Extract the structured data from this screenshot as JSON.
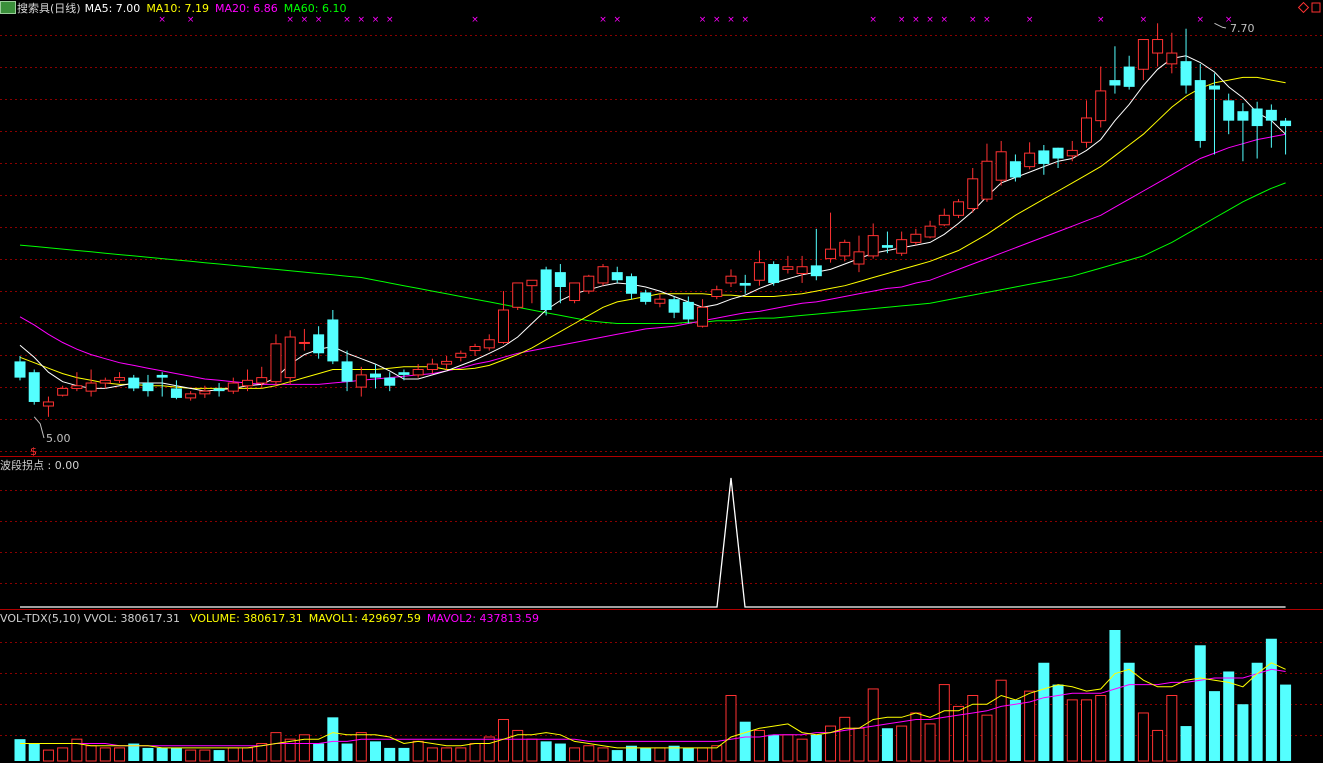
{
  "header": {
    "title": "搜索具(日线)",
    "ma5_label": "MA5: 7.00",
    "ma10_label": "MA10: 7.19",
    "ma20_label": "MA20: 6.86",
    "ma60_label": "MA60: 6.10"
  },
  "indicator": {
    "label": "波段拐点 : 0.00"
  },
  "volume_header": {
    "name": "VOL-TDX(5,10)",
    "vvol": "VVOL: 380617.31",
    "volume": "VOLUME: 380617.31",
    "mavol1": "MAVOL1: 429697.59",
    "mavol2": "MAVOL2: 437813.59"
  },
  "annotations": {
    "high_label": "7.70",
    "low_label": "5.00",
    "buy_mark": "$"
  },
  "colors": {
    "up": "#ff3232",
    "down": "#54ffff",
    "ma5": "#ffffff",
    "ma10": "#ffff00",
    "ma20": "#ff00ff",
    "ma60": "#00ff00",
    "grid": "#8a0000",
    "signal": "#ff00ff"
  },
  "chart_data": {
    "type": "candlestick",
    "price_range": [
      4.75,
      7.9
    ],
    "x": [
      0,
      1,
      2,
      3,
      4,
      5,
      6,
      7,
      8,
      9,
      10,
      11,
      12,
      13,
      14,
      15,
      16,
      17,
      18,
      19,
      20,
      21,
      22,
      23,
      24,
      25,
      26,
      27,
      28,
      29,
      30,
      31,
      32,
      33,
      34,
      35,
      36,
      37,
      38,
      39,
      40,
      41,
      42,
      43,
      44,
      45,
      46,
      47,
      48,
      49,
      50,
      51,
      52,
      53,
      54,
      55,
      56,
      57,
      58,
      59,
      60,
      61,
      62,
      63,
      64,
      65,
      66,
      67,
      68,
      69,
      70,
      71,
      72,
      73,
      74,
      75,
      76,
      77,
      78,
      79,
      80,
      81,
      82,
      83,
      84,
      85,
      86,
      87,
      88,
      89
    ],
    "open": [
      5.42,
      5.34,
      5.09,
      5.17,
      5.22,
      5.2,
      5.26,
      5.28,
      5.3,
      5.26,
      5.32,
      5.22,
      5.15,
      5.18,
      5.22,
      5.2,
      5.24,
      5.26,
      5.27,
      5.3,
      5.56,
      5.62,
      5.73,
      5.42,
      5.23,
      5.33,
      5.3,
      5.34,
      5.32,
      5.36,
      5.4,
      5.45,
      5.5,
      5.52,
      5.56,
      5.82,
      5.98,
      6.1,
      6.08,
      5.87,
      5.94,
      6.0,
      6.08,
      6.05,
      5.93,
      5.85,
      5.88,
      5.86,
      5.68,
      5.9,
      6.0,
      6.0,
      6.02,
      6.14,
      6.1,
      6.07,
      6.13,
      6.18,
      6.2,
      6.14,
      6.2,
      6.28,
      6.22,
      6.3,
      6.34,
      6.43,
      6.5,
      6.55,
      6.62,
      6.76,
      6.9,
      6.86,
      6.98,
      7.0,
      6.94,
      7.04,
      7.2,
      7.5,
      7.6,
      7.58,
      7.7,
      7.62,
      7.64,
      7.5,
      7.46,
      7.35,
      7.27,
      7.29,
      7.28,
      7.2
    ],
    "close": [
      5.3,
      5.12,
      5.12,
      5.22,
      5.24,
      5.26,
      5.28,
      5.3,
      5.22,
      5.2,
      5.3,
      5.15,
      5.18,
      5.2,
      5.2,
      5.26,
      5.28,
      5.3,
      5.55,
      5.6,
      5.56,
      5.48,
      5.42,
      5.27,
      5.32,
      5.3,
      5.24,
      5.32,
      5.36,
      5.4,
      5.42,
      5.48,
      5.53,
      5.58,
      5.8,
      6.0,
      6.02,
      5.8,
      5.97,
      6.0,
      6.05,
      6.12,
      6.02,
      5.92,
      5.86,
      5.88,
      5.78,
      5.73,
      5.82,
      5.95,
      6.05,
      5.98,
      6.15,
      6.0,
      6.12,
      6.12,
      6.05,
      6.25,
      6.3,
      6.23,
      6.35,
      6.26,
      6.32,
      6.36,
      6.42,
      6.5,
      6.6,
      6.77,
      6.9,
      6.97,
      6.78,
      6.96,
      6.88,
      6.92,
      6.98,
      7.22,
      7.42,
      7.46,
      7.45,
      7.8,
      7.8,
      7.7,
      7.46,
      7.05,
      7.43,
      7.2,
      7.2,
      7.16,
      7.2,
      7.16
    ],
    "high": [
      5.46,
      5.36,
      5.16,
      5.24,
      5.34,
      5.36,
      5.3,
      5.34,
      5.32,
      5.32,
      5.34,
      5.28,
      5.2,
      5.24,
      5.26,
      5.3,
      5.36,
      5.38,
      5.62,
      5.65,
      5.66,
      5.68,
      5.8,
      5.5,
      5.38,
      5.4,
      5.34,
      5.36,
      5.4,
      5.44,
      5.46,
      5.5,
      5.55,
      5.62,
      5.94,
      5.96,
      6.02,
      6.12,
      6.14,
      6.0,
      6.06,
      6.14,
      6.12,
      6.07,
      5.95,
      5.92,
      5.9,
      5.9,
      5.88,
      5.98,
      6.1,
      6.06,
      6.24,
      6.16,
      6.2,
      6.2,
      6.4,
      6.52,
      6.32,
      6.35,
      6.44,
      6.38,
      6.38,
      6.4,
      6.46,
      6.55,
      6.62,
      6.85,
      7.03,
      7.05,
      6.95,
      7.04,
      7.02,
      7.0,
      7.05,
      7.35,
      7.6,
      7.75,
      7.68,
      7.8,
      7.92,
      7.85,
      7.88,
      7.62,
      7.55,
      7.4,
      7.33,
      7.34,
      7.32,
      7.22
    ],
    "low": [
      5.28,
      5.1,
      5.01,
      5.16,
      5.2,
      5.16,
      5.22,
      5.26,
      5.2,
      5.16,
      5.16,
      5.14,
      5.13,
      5.15,
      5.16,
      5.18,
      5.2,
      5.22,
      5.24,
      5.25,
      5.5,
      5.44,
      5.4,
      5.2,
      5.16,
      5.22,
      5.2,
      5.28,
      5.3,
      5.33,
      5.36,
      5.42,
      5.46,
      5.5,
      5.55,
      5.8,
      5.85,
      5.76,
      5.85,
      5.85,
      5.92,
      5.98,
      6.0,
      5.88,
      5.84,
      5.82,
      5.74,
      5.7,
      5.67,
      5.88,
      5.97,
      5.92,
      5.98,
      5.98,
      6.07,
      6.0,
      6.02,
      6.15,
      6.16,
      6.08,
      6.18,
      6.22,
      6.2,
      6.28,
      6.33,
      6.42,
      6.48,
      6.52,
      6.6,
      6.72,
      6.75,
      6.84,
      6.8,
      6.85,
      6.9,
      7.0,
      7.15,
      7.4,
      7.43,
      7.5,
      7.6,
      7.55,
      7.4,
      7.0,
      6.95,
      7.1,
      6.9,
      6.92,
      7.0,
      6.95
    ],
    "ma5": [
      5.54,
      5.45,
      5.34,
      5.27,
      5.24,
      5.22,
      5.22,
      5.24,
      5.26,
      5.26,
      5.26,
      5.24,
      5.22,
      5.2,
      5.21,
      5.22,
      5.24,
      5.25,
      5.3,
      5.4,
      5.47,
      5.51,
      5.53,
      5.48,
      5.44,
      5.4,
      5.35,
      5.29,
      5.29,
      5.32,
      5.35,
      5.39,
      5.43,
      5.48,
      5.53,
      5.6,
      5.7,
      5.8,
      5.87,
      5.92,
      5.95,
      5.98,
      6.0,
      5.99,
      5.97,
      5.94,
      5.9,
      5.86,
      5.82,
      5.84,
      5.88,
      5.91,
      5.96,
      6.0,
      6.03,
      6.06,
      6.08,
      6.1,
      6.14,
      6.18,
      6.22,
      6.24,
      6.26,
      6.28,
      6.3,
      6.36,
      6.44,
      6.53,
      6.64,
      6.74,
      6.78,
      6.82,
      6.86,
      6.9,
      6.92,
      6.98,
      7.06,
      7.2,
      7.32,
      7.46,
      7.58,
      7.66,
      7.68,
      7.63,
      7.56,
      7.45,
      7.37,
      7.26,
      7.2,
      7.1
    ],
    "ma10": [
      5.45,
      5.41,
      5.37,
      5.33,
      5.3,
      5.28,
      5.26,
      5.25,
      5.25,
      5.24,
      5.24,
      5.23,
      5.22,
      5.22,
      5.22,
      5.22,
      5.22,
      5.22,
      5.24,
      5.27,
      5.3,
      5.33,
      5.36,
      5.36,
      5.36,
      5.36,
      5.37,
      5.38,
      5.38,
      5.38,
      5.36,
      5.36,
      5.37,
      5.39,
      5.43,
      5.47,
      5.52,
      5.58,
      5.64,
      5.7,
      5.76,
      5.82,
      5.86,
      5.88,
      5.9,
      5.92,
      5.92,
      5.92,
      5.92,
      5.91,
      5.91,
      5.9,
      5.9,
      5.9,
      5.91,
      5.92,
      5.94,
      5.96,
      5.98,
      6.01,
      6.04,
      6.07,
      6.1,
      6.13,
      6.16,
      6.2,
      6.24,
      6.3,
      6.36,
      6.43,
      6.5,
      6.56,
      6.62,
      6.68,
      6.74,
      6.8,
      6.86,
      6.94,
      7.02,
      7.1,
      7.2,
      7.3,
      7.38,
      7.44,
      7.48,
      7.5,
      7.52,
      7.52,
      7.5,
      7.48
    ],
    "ma20": [
      5.75,
      5.69,
      5.62,
      5.56,
      5.51,
      5.47,
      5.44,
      5.41,
      5.39,
      5.37,
      5.35,
      5.33,
      5.31,
      5.29,
      5.28,
      5.27,
      5.26,
      5.25,
      5.25,
      5.25,
      5.25,
      5.25,
      5.26,
      5.27,
      5.28,
      5.29,
      5.3,
      5.31,
      5.32,
      5.33,
      5.35,
      5.37,
      5.4,
      5.42,
      5.45,
      5.48,
      5.5,
      5.52,
      5.54,
      5.56,
      5.58,
      5.6,
      5.62,
      5.64,
      5.66,
      5.67,
      5.68,
      5.7,
      5.72,
      5.74,
      5.76,
      5.78,
      5.79,
      5.81,
      5.83,
      5.85,
      5.86,
      5.88,
      5.9,
      5.92,
      5.94,
      5.96,
      5.97,
      6.0,
      6.02,
      6.06,
      6.1,
      6.14,
      6.18,
      6.22,
      6.26,
      6.3,
      6.34,
      6.38,
      6.42,
      6.46,
      6.5,
      6.56,
      6.62,
      6.68,
      6.74,
      6.8,
      6.86,
      6.92,
      6.96,
      7.0,
      7.03,
      7.06,
      7.08,
      7.1
    ],
    "ma60": [
      6.28,
      6.27,
      6.26,
      6.25,
      6.24,
      6.23,
      6.22,
      6.21,
      6.2,
      6.19,
      6.18,
      6.17,
      6.16,
      6.15,
      6.14,
      6.13,
      6.12,
      6.11,
      6.1,
      6.09,
      6.08,
      6.07,
      6.06,
      6.05,
      6.04,
      6.02,
      6.0,
      5.98,
      5.96,
      5.94,
      5.92,
      5.9,
      5.88,
      5.86,
      5.84,
      5.82,
      5.8,
      5.78,
      5.76,
      5.74,
      5.72,
      5.71,
      5.7,
      5.7,
      5.7,
      5.7,
      5.7,
      5.71,
      5.71,
      5.72,
      5.72,
      5.73,
      5.74,
      5.74,
      5.75,
      5.76,
      5.77,
      5.78,
      5.79,
      5.8,
      5.81,
      5.82,
      5.83,
      5.84,
      5.85,
      5.87,
      5.89,
      5.91,
      5.93,
      5.95,
      5.97,
      5.99,
      6.01,
      6.03,
      6.05,
      6.08,
      6.11,
      6.14,
      6.17,
      6.2,
      6.25,
      6.3,
      6.36,
      6.42,
      6.48,
      6.54,
      6.6,
      6.65,
      6.7,
      6.74
    ],
    "signal_marks": [
      10,
      12,
      19,
      20,
      21,
      23,
      24,
      25,
      26,
      32,
      41,
      42,
      48,
      49,
      50,
      51,
      60,
      62,
      63,
      64,
      65,
      67,
      68,
      71,
      76,
      79,
      83,
      85
    ],
    "volume": [
      0.1,
      0.08,
      0.05,
      0.06,
      0.1,
      0.07,
      0.06,
      0.06,
      0.08,
      0.06,
      0.06,
      0.06,
      0.05,
      0.05,
      0.05,
      0.06,
      0.06,
      0.08,
      0.13,
      0.1,
      0.12,
      0.08,
      0.2,
      0.08,
      0.13,
      0.09,
      0.06,
      0.06,
      0.09,
      0.06,
      0.06,
      0.06,
      0.08,
      0.11,
      0.19,
      0.14,
      0.1,
      0.09,
      0.08,
      0.06,
      0.07,
      0.06,
      0.05,
      0.07,
      0.06,
      0.06,
      0.07,
      0.06,
      0.06,
      0.07,
      0.3,
      0.18,
      0.14,
      0.12,
      0.12,
      0.1,
      0.12,
      0.16,
      0.2,
      0.15,
      0.33,
      0.15,
      0.16,
      0.22,
      0.17,
      0.35,
      0.25,
      0.3,
      0.21,
      0.37,
      0.28,
      0.32,
      0.45,
      0.35,
      0.28,
      0.28,
      0.3,
      0.6,
      0.45,
      0.22,
      0.14,
      0.3,
      0.16,
      0.53,
      0.32,
      0.41,
      0.26,
      0.45,
      0.56,
      0.35
    ],
    "mavol1": [
      0.08,
      0.08,
      0.08,
      0.08,
      0.08,
      0.07,
      0.07,
      0.07,
      0.07,
      0.07,
      0.06,
      0.06,
      0.06,
      0.06,
      0.06,
      0.06,
      0.06,
      0.07,
      0.08,
      0.09,
      0.1,
      0.1,
      0.13,
      0.12,
      0.12,
      0.12,
      0.11,
      0.08,
      0.09,
      0.08,
      0.07,
      0.07,
      0.08,
      0.08,
      0.1,
      0.12,
      0.12,
      0.13,
      0.12,
      0.09,
      0.08,
      0.07,
      0.06,
      0.06,
      0.06,
      0.06,
      0.06,
      0.06,
      0.06,
      0.06,
      0.11,
      0.13,
      0.15,
      0.16,
      0.17,
      0.13,
      0.12,
      0.13,
      0.15,
      0.15,
      0.19,
      0.2,
      0.2,
      0.22,
      0.2,
      0.23,
      0.23,
      0.26,
      0.26,
      0.3,
      0.28,
      0.31,
      0.33,
      0.35,
      0.34,
      0.32,
      0.33,
      0.4,
      0.42,
      0.37,
      0.34,
      0.34,
      0.37,
      0.38,
      0.37,
      0.36,
      0.34,
      0.4,
      0.45,
      0.42
    ],
    "mavol2": [
      0.08,
      0.08,
      0.08,
      0.08,
      0.08,
      0.08,
      0.08,
      0.07,
      0.07,
      0.07,
      0.07,
      0.07,
      0.07,
      0.07,
      0.07,
      0.07,
      0.07,
      0.07,
      0.08,
      0.08,
      0.08,
      0.08,
      0.09,
      0.09,
      0.1,
      0.1,
      0.1,
      0.1,
      0.1,
      0.1,
      0.1,
      0.1,
      0.1,
      0.1,
      0.1,
      0.1,
      0.1,
      0.1,
      0.1,
      0.1,
      0.09,
      0.09,
      0.09,
      0.09,
      0.09,
      0.09,
      0.09,
      0.09,
      0.09,
      0.09,
      0.1,
      0.11,
      0.11,
      0.12,
      0.12,
      0.12,
      0.13,
      0.13,
      0.14,
      0.15,
      0.16,
      0.17,
      0.18,
      0.19,
      0.19,
      0.2,
      0.21,
      0.22,
      0.23,
      0.25,
      0.26,
      0.27,
      0.29,
      0.3,
      0.31,
      0.31,
      0.31,
      0.33,
      0.35,
      0.35,
      0.35,
      0.36,
      0.36,
      0.37,
      0.38,
      0.38,
      0.38,
      0.4,
      0.42,
      0.41
    ],
    "indicator_values": [
      0,
      0,
      0,
      0,
      0,
      0,
      0,
      0,
      0,
      0,
      0,
      0,
      0,
      0,
      0,
      0,
      0,
      0,
      0,
      0,
      0,
      0,
      0,
      0,
      0,
      0,
      0,
      0,
      0,
      0,
      0,
      0,
      0,
      0,
      0,
      0,
      0,
      0,
      0,
      0,
      0,
      0,
      0,
      0,
      0,
      0,
      0,
      0,
      0,
      0,
      1,
      0,
      0,
      0,
      0,
      0,
      0,
      0,
      0,
      0,
      0,
      0,
      0,
      0,
      0,
      0,
      0,
      0,
      0,
      0,
      0,
      0,
      0,
      0,
      0,
      0,
      0,
      0,
      0,
      0,
      0,
      0,
      0,
      0,
      0,
      0,
      0,
      0,
      0,
      0
    ]
  }
}
